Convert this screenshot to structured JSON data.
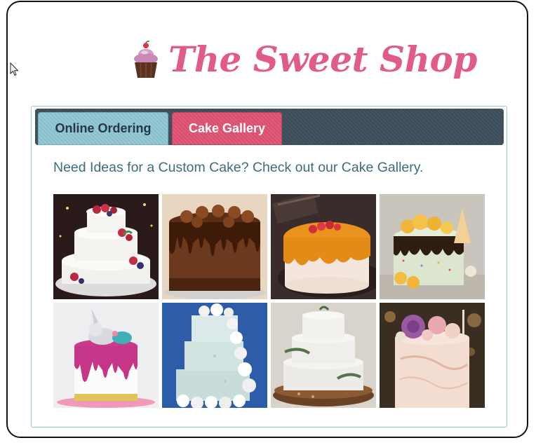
{
  "header": {
    "title": "The Sweet Shop",
    "logo_icon": "cupcake-icon",
    "title_color": "#e05b86"
  },
  "tabs": [
    {
      "label": "Online Ordering",
      "active": false,
      "color": "#8ec6d2"
    },
    {
      "label": "Cake Gallery",
      "active": true,
      "color": "#e05272"
    }
  ],
  "gallery": {
    "intro_text": "Need Ideas for a Custom Cake? Check out our Cake Gallery.",
    "images": [
      {
        "name": "cake-photo-berry-cascade",
        "subject": "white tiered cake with berries"
      },
      {
        "name": "cake-photo-chocolate-drip",
        "subject": "chocolate drip cake with rosettes"
      },
      {
        "name": "cake-photo-caramel-glaze",
        "subject": "orange glazed cake with strawberries"
      },
      {
        "name": "cake-photo-macaron-drip",
        "subject": "drip cake with macarons"
      },
      {
        "name": "cake-photo-unicorn",
        "subject": "white cake with pink drip and unicorn"
      },
      {
        "name": "cake-photo-wedding-roses",
        "subject": "tiered cake with white roses"
      },
      {
        "name": "cake-photo-rustic-tiers",
        "subject": "rustic white tiered cake on wood"
      },
      {
        "name": "cake-photo-floral-buttercream",
        "subject": "cake topped with flowers"
      }
    ]
  }
}
